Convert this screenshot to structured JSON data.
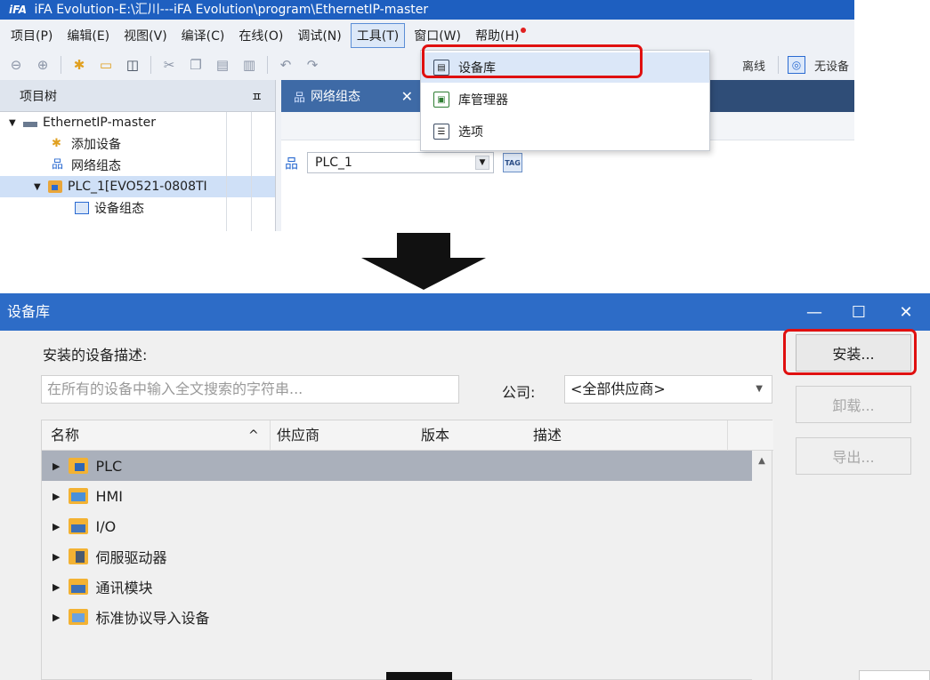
{
  "ide": {
    "title": "iFA Evolution-E:\\汇川---iFA Evolution\\program\\EthernetIP-master",
    "logo": "iFA",
    "menu": [
      {
        "label": "项目(P)"
      },
      {
        "label": "编辑(E)"
      },
      {
        "label": "视图(V)"
      },
      {
        "label": "编译(C)"
      },
      {
        "label": "在线(O)"
      },
      {
        "label": "调试(N)"
      },
      {
        "label": "工具(T)",
        "active": true
      },
      {
        "label": "窗口(W)"
      },
      {
        "label": "帮助(H)",
        "dot": true
      }
    ],
    "toolbar_right": {
      "offline": "离线",
      "no_device": "无设备"
    },
    "project_tree": {
      "header": "项目树",
      "pin": "ㅍ",
      "items": [
        {
          "label": "EthernetIP-master"
        },
        {
          "label": "添加设备"
        },
        {
          "label": "网络组态"
        },
        {
          "label": "PLC_1[EVO521-0808TI"
        },
        {
          "label": "设备组态"
        }
      ]
    },
    "editor_tab": {
      "label": "网络组态",
      "close": "✕"
    },
    "plc_select": "PLC_1",
    "tag_button": "TAG",
    "tools_menu": [
      {
        "label": "设备库",
        "highlighted": true
      },
      {
        "label": "库管理器"
      },
      {
        "label": "选项"
      }
    ]
  },
  "dialog": {
    "title": "设备库",
    "window_controls": {
      "minimize": "—",
      "maximize": "☐",
      "close": "✕"
    },
    "description_label": "安装的设备描述:",
    "search_placeholder": "在所有的设备中输入全文搜索的字符串...",
    "company_label": "公司:",
    "company_value": "<全部供应商>",
    "columns": [
      "名称",
      "供应商",
      "版本",
      "描述"
    ],
    "sort_indicator": "^",
    "rows": [
      {
        "label": "PLC",
        "icon": "plc-icon",
        "selected": true
      },
      {
        "label": "HMI",
        "icon": "hmi-icon"
      },
      {
        "label": "I/O",
        "icon": "io-icon"
      },
      {
        "label": "伺服驱动器",
        "icon": "servo-drive-icon"
      },
      {
        "label": "通讯模块",
        "icon": "comm-module-icon"
      },
      {
        "label": "标准协议导入设备",
        "icon": "standard-protocol-icon"
      }
    ],
    "buttons": {
      "install": "安装...",
      "uninstall": "卸载...",
      "export": "导出..."
    }
  },
  "colors": {
    "highlight_red": "#e01010",
    "title_blue": "#2d6cc7",
    "accent_blue": "#1e5fc0"
  }
}
